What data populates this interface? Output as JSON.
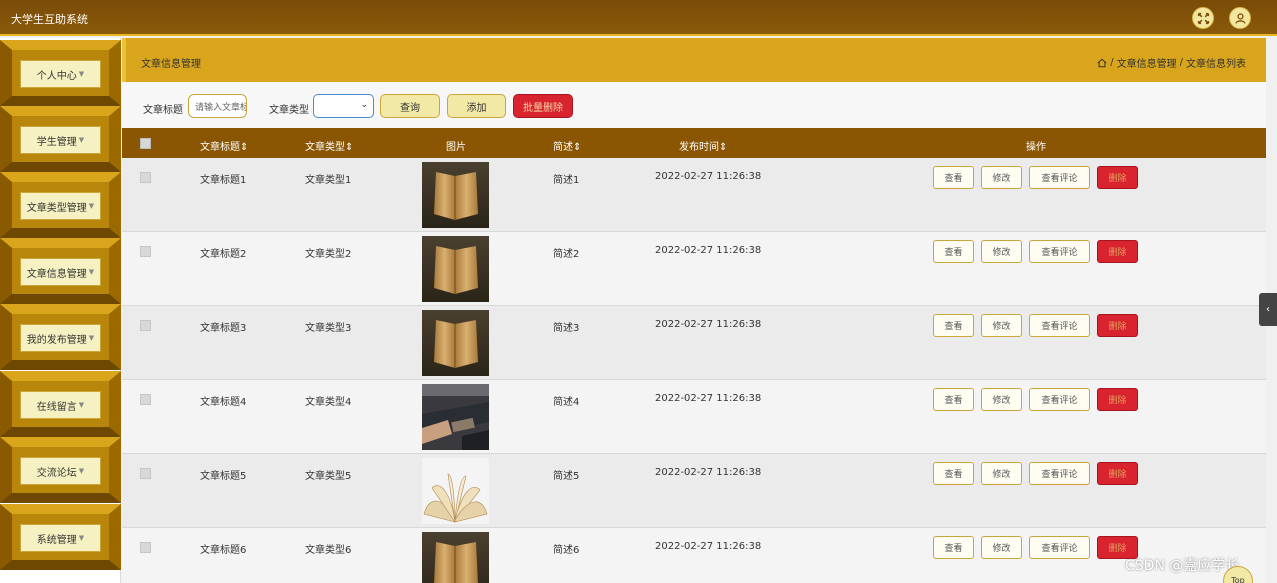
{
  "app": {
    "title": "大学生互助系统"
  },
  "colors": {
    "accent": "#d8a51c",
    "header_dark": "#8a5603",
    "danger": "#d9232e"
  },
  "sidebar": {
    "items": [
      {
        "label": "个人中心"
      },
      {
        "label": "学生管理"
      },
      {
        "label": "文章类型管理"
      },
      {
        "label": "文章信息管理"
      },
      {
        "label": "我的发布管理"
      },
      {
        "label": "在线留言"
      },
      {
        "label": "交流论坛"
      },
      {
        "label": "系统管理"
      }
    ]
  },
  "header": {
    "page_title": "文章信息管理",
    "breadcrumb": [
      "文章信息管理",
      "文章信息列表"
    ],
    "breadcrumb_sep": "/"
  },
  "filters": {
    "title_label": "文章标题",
    "title_placeholder": "请输入文章标题",
    "type_label": "文章类型",
    "type_value": "",
    "search_label": "查询",
    "add_label": "添加",
    "batch_delete_label": "批量删除"
  },
  "table": {
    "columns": [
      "文章标题",
      "文章类型",
      "图片",
      "简述",
      "发布时间",
      "操作"
    ],
    "rows": [
      {
        "title": "文章标题1",
        "type": "文章类型1",
        "image": "book-open-upright",
        "summary": "简述1",
        "time": "2022-02-27 11:26:38"
      },
      {
        "title": "文章标题2",
        "type": "文章类型2",
        "image": "book-open-upright",
        "summary": "简述2",
        "time": "2022-02-27 11:26:38"
      },
      {
        "title": "文章标题3",
        "type": "文章类型3",
        "image": "book-open-upright",
        "summary": "简述3",
        "time": "2022-02-27 11:26:38"
      },
      {
        "title": "文章标题4",
        "type": "文章类型4",
        "image": "library-photo",
        "summary": "简述4",
        "time": "2022-02-27 11:26:38"
      },
      {
        "title": "文章标题5",
        "type": "文章类型5",
        "image": "book-fanned",
        "summary": "简述5",
        "time": "2022-02-27 11:26:38"
      },
      {
        "title": "文章标题6",
        "type": "文章类型6",
        "image": "book-open-upright",
        "summary": "简述6",
        "time": "2022-02-27 11:26:38"
      }
    ],
    "actions": {
      "view": "查看",
      "edit": "修改",
      "comments": "查看评论",
      "delete": "删除"
    }
  },
  "watermark": "CSDN @嘉应学长",
  "top_button": "Top"
}
